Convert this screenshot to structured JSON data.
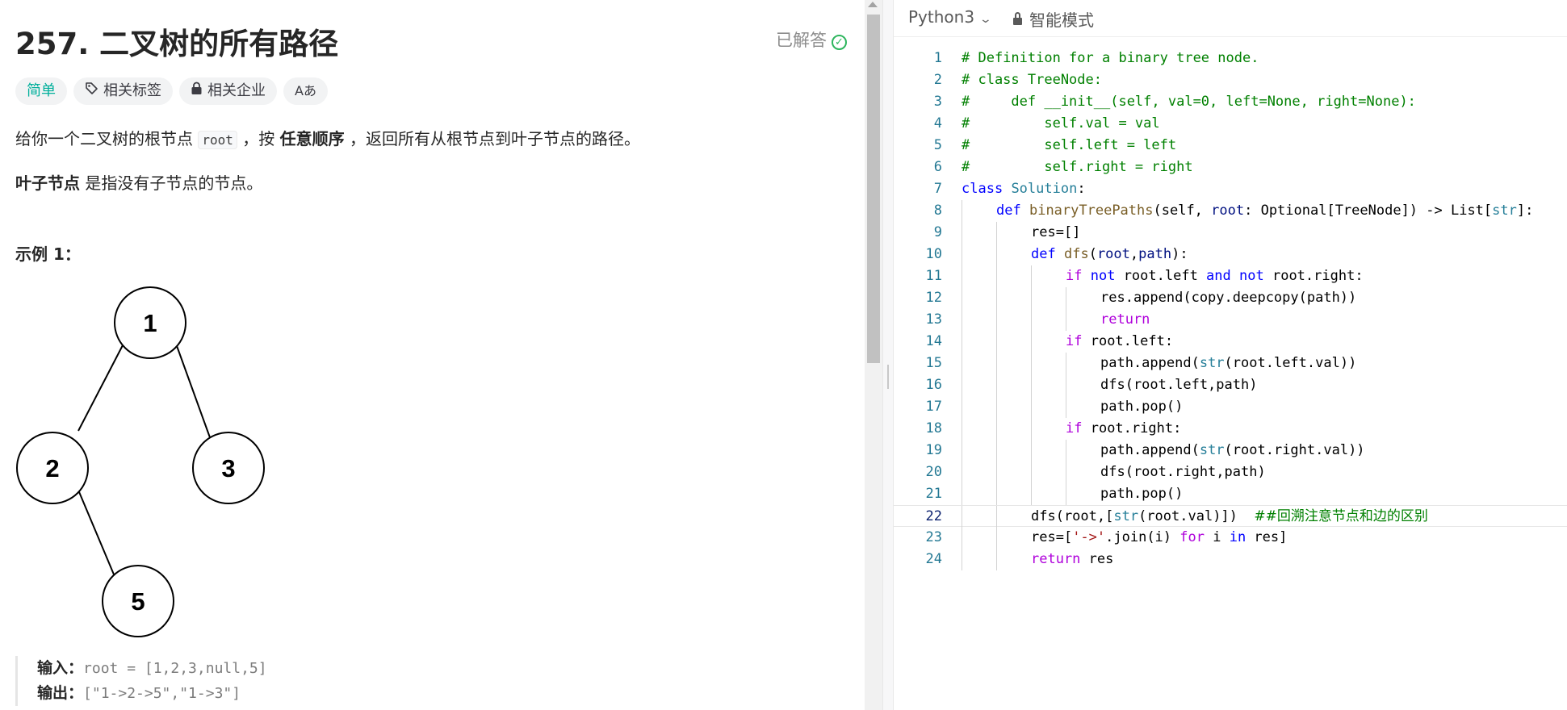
{
  "problem": {
    "title": "257. 二叉树的所有路径",
    "status_label": "已解答",
    "tags": [
      {
        "label": "简单"
      },
      {
        "label": "相关标签"
      },
      {
        "label": "相关企业"
      },
      {
        "label": "Aあ"
      }
    ],
    "desc1_before": "给你一个二叉树的根节点 ",
    "desc1_code": "root",
    "desc1_mid": " ，按 ",
    "desc1_bold": "任意顺序",
    "desc1_after": " ，返回所有从根节点到叶子节点的路径。",
    "desc2_bold": "叶子节点",
    "desc2_after": " 是指没有子节点的节点。",
    "example_heading": "示例 1：",
    "tree_nodes": [
      "1",
      "2",
      "3",
      "5"
    ],
    "input_label": "输入：",
    "input_value": "root = [1,2,3,null,5]",
    "output_label": "输出：",
    "output_value": "[\"1->2->5\",\"1->3\"]"
  },
  "editor": {
    "language": "Python3",
    "mode": "智能模式",
    "active_line": 22,
    "lines": [
      {
        "n": "1",
        "indent": 0,
        "tokens": [
          [
            "cm",
            "# Definition for a binary tree node."
          ]
        ]
      },
      {
        "n": "2",
        "indent": 0,
        "tokens": [
          [
            "cm",
            "# class TreeNode:"
          ]
        ]
      },
      {
        "n": "3",
        "indent": 0,
        "tokens": [
          [
            "cm",
            "#     def __init__(self, val=0, left=None, right=None):"
          ]
        ]
      },
      {
        "n": "4",
        "indent": 0,
        "tokens": [
          [
            "cm",
            "#         self.val = val"
          ]
        ]
      },
      {
        "n": "5",
        "indent": 0,
        "tokens": [
          [
            "cm",
            "#         self.left = left"
          ]
        ]
      },
      {
        "n": "6",
        "indent": 0,
        "tokens": [
          [
            "cm",
            "#         self.right = right"
          ]
        ]
      },
      {
        "n": "7",
        "indent": 0,
        "tokens": [
          [
            "kw",
            "class"
          ],
          [
            "",
            " "
          ],
          [
            "cl",
            "Solution"
          ],
          [
            "",
            ":"
          ]
        ]
      },
      {
        "n": "8",
        "indent": 1,
        "tokens": [
          [
            "kw",
            "def"
          ],
          [
            "",
            " "
          ],
          [
            "fn",
            "binaryTreePaths"
          ],
          [
            "",
            "(self, "
          ],
          [
            "pa",
            "root"
          ],
          [
            "",
            ": Optional[TreeNode]) -> List["
          ],
          [
            "cl",
            "str"
          ],
          [
            "",
            "]:"
          ]
        ]
      },
      {
        "n": "9",
        "indent": 2,
        "tokens": [
          [
            "",
            "res=[]"
          ]
        ]
      },
      {
        "n": "10",
        "indent": 2,
        "tokens": [
          [
            "kw",
            "def"
          ],
          [
            "",
            " "
          ],
          [
            "fn",
            "dfs"
          ],
          [
            "",
            "("
          ],
          [
            "pa",
            "root"
          ],
          [
            "",
            ","
          ],
          [
            "pa",
            "path"
          ],
          [
            "",
            "):"
          ]
        ]
      },
      {
        "n": "11",
        "indent": 3,
        "tokens": [
          [
            "kc",
            "if"
          ],
          [
            "",
            " "
          ],
          [
            "kw",
            "not"
          ],
          [
            "",
            " root.left "
          ],
          [
            "kw",
            "and"
          ],
          [
            "",
            " "
          ],
          [
            "kw",
            "not"
          ],
          [
            "",
            " root.right:"
          ]
        ]
      },
      {
        "n": "12",
        "indent": 4,
        "tokens": [
          [
            "",
            "res.append(copy.deepcopy(path))"
          ]
        ]
      },
      {
        "n": "13",
        "indent": 4,
        "tokens": [
          [
            "kc",
            "return"
          ]
        ]
      },
      {
        "n": "14",
        "indent": 3,
        "tokens": [
          [
            "kc",
            "if"
          ],
          [
            "",
            " root.left:"
          ]
        ]
      },
      {
        "n": "15",
        "indent": 4,
        "tokens": [
          [
            "",
            "path.append("
          ],
          [
            "cl",
            "str"
          ],
          [
            "",
            "(root.left.val))"
          ]
        ]
      },
      {
        "n": "16",
        "indent": 4,
        "tokens": [
          [
            "",
            "dfs(root.left,path)"
          ]
        ]
      },
      {
        "n": "17",
        "indent": 4,
        "tokens": [
          [
            "",
            "path.pop()"
          ]
        ]
      },
      {
        "n": "18",
        "indent": 3,
        "tokens": [
          [
            "kc",
            "if"
          ],
          [
            "",
            " root.right:"
          ]
        ]
      },
      {
        "n": "19",
        "indent": 4,
        "tokens": [
          [
            "",
            "path.append("
          ],
          [
            "cl",
            "str"
          ],
          [
            "",
            "(root.right.val))"
          ]
        ]
      },
      {
        "n": "20",
        "indent": 4,
        "tokens": [
          [
            "",
            "dfs(root.right,path)"
          ]
        ]
      },
      {
        "n": "21",
        "indent": 4,
        "tokens": [
          [
            "",
            "path.pop()"
          ]
        ]
      },
      {
        "n": "22",
        "indent": 2,
        "tokens": [
          [
            "",
            "dfs(root,["
          ],
          [
            "cl",
            "str"
          ],
          [
            "",
            "(root.val)])  "
          ],
          [
            "cmcn",
            "##回溯注意节点和边的区别"
          ]
        ]
      },
      {
        "n": "23",
        "indent": 2,
        "tokens": [
          [
            "",
            "res=["
          ],
          [
            "st",
            "'->'"
          ],
          [
            "",
            ".join(i) "
          ],
          [
            "kc",
            "for"
          ],
          [
            "",
            " i "
          ],
          [
            "kw",
            "in"
          ],
          [
            "",
            " res]"
          ]
        ]
      },
      {
        "n": "24",
        "indent": 2,
        "tokens": [
          [
            "kc",
            "return"
          ],
          [
            "",
            " res"
          ]
        ]
      }
    ]
  },
  "colors": {
    "easy": "#00af9b",
    "solved_check": "#2db55d",
    "line_number": "#237893",
    "comment": "#008000",
    "keyword": "#0000ff"
  }
}
